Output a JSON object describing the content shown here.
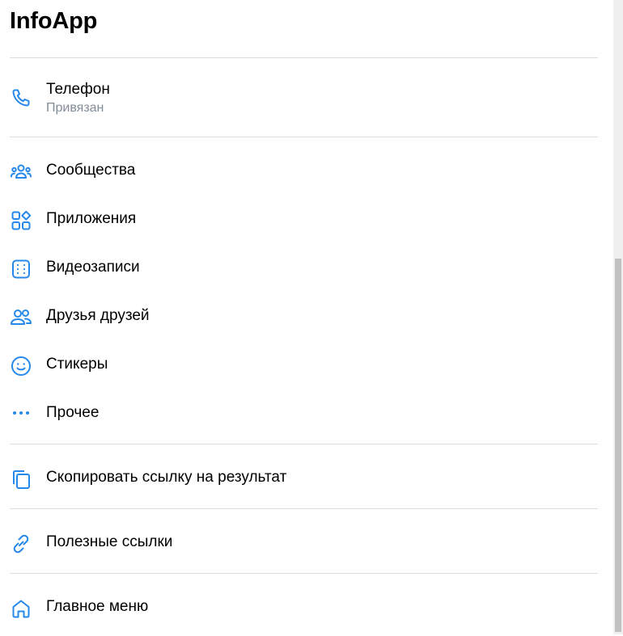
{
  "header": {
    "title": "InfoApp"
  },
  "phone": {
    "label": "Телефон",
    "status": "Привязан",
    "icon": "phone-icon"
  },
  "menu": {
    "items": [
      {
        "label": "Сообщества",
        "icon": "users-group-icon"
      },
      {
        "label": "Приложения",
        "icon": "apps-grid-icon"
      },
      {
        "label": "Видеозаписи",
        "icon": "video-icon"
      },
      {
        "label": "Друзья друзей",
        "icon": "friends-icon"
      },
      {
        "label": "Стикеры",
        "icon": "smile-icon"
      },
      {
        "label": "Прочее",
        "icon": "more-dots-icon"
      }
    ]
  },
  "actions": {
    "copy_link": {
      "label": "Скопировать ссылку на результат",
      "icon": "copy-icon"
    },
    "useful_links": {
      "label": "Полезные ссылки",
      "icon": "link-icon"
    },
    "main_menu": {
      "label": "Главное меню",
      "icon": "home-icon"
    }
  },
  "colors": {
    "accent": "#2688eb",
    "divider": "#dcdcdc",
    "secondary_text": "#818c99"
  }
}
